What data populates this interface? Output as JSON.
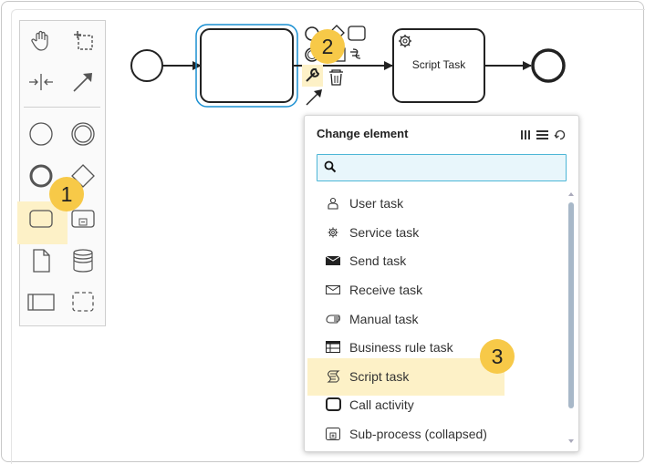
{
  "palette": {
    "tools": [
      {
        "name": "hand-tool-icon"
      },
      {
        "name": "lasso-tool-icon"
      },
      {
        "name": "space-tool-icon"
      },
      {
        "name": "connect-tool-icon"
      },
      {
        "name": "start-event-icon"
      },
      {
        "name": "intermediate-event-icon"
      },
      {
        "name": "end-event-icon"
      },
      {
        "name": "gateway-icon"
      },
      {
        "name": "task-icon"
      },
      {
        "name": "subprocess-icon"
      },
      {
        "name": "data-object-icon"
      },
      {
        "name": "data-store-icon"
      },
      {
        "name": "pool-icon"
      },
      {
        "name": "group-icon"
      }
    ]
  },
  "badges": {
    "one": "1",
    "two": "2",
    "three": "3"
  },
  "diagram": {
    "script_task_label": "Script Task"
  },
  "popup": {
    "title": "Change element",
    "search_value": "",
    "items": [
      {
        "label": "User task",
        "icon": "user-task-icon"
      },
      {
        "label": "Service task",
        "icon": "service-task-icon"
      },
      {
        "label": "Send task",
        "icon": "send-task-icon"
      },
      {
        "label": "Receive task",
        "icon": "receive-task-icon"
      },
      {
        "label": "Manual task",
        "icon": "manual-task-icon"
      },
      {
        "label": "Business rule task",
        "icon": "business-rule-task-icon"
      },
      {
        "label": "Script task",
        "icon": "script-task-icon"
      },
      {
        "label": "Call activity",
        "icon": "call-activity-icon"
      },
      {
        "label": "Sub-process (collapsed)",
        "icon": "subprocess-collapsed-icon"
      }
    ]
  },
  "colors": {
    "highlight": "#fdf1c7",
    "badge": "#f7c948",
    "selection": "#1a8fd1",
    "search_border": "#4db6d6"
  }
}
